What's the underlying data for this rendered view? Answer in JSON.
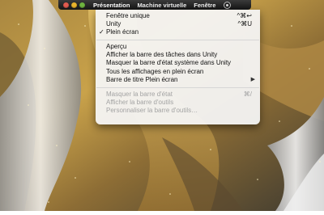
{
  "menubar": {
    "traffic_lights": [
      {
        "name": "close",
        "color": "#e25b4f"
      },
      {
        "name": "minimize",
        "color": "#e9b32c"
      },
      {
        "name": "zoom",
        "color": "#6fb33f"
      }
    ],
    "menus": [
      "Présentation",
      "Machine virtuelle",
      "Fenêtre"
    ],
    "active_menu": "Présentation",
    "status_icon": "vm-status-icon"
  },
  "dropdown": {
    "groups": [
      [
        {
          "label": "Fenêtre unique",
          "shortcut": "^⌘↩",
          "checked": false,
          "enabled": true
        },
        {
          "label": "Unity",
          "shortcut": "^⌘U",
          "checked": false,
          "enabled": true
        },
        {
          "label": "Plein écran",
          "shortcut": "",
          "checked": true,
          "enabled": true
        }
      ],
      [
        {
          "label": "Aperçu",
          "shortcut": "",
          "checked": false,
          "enabled": true
        },
        {
          "label": "Afficher la barre des tâches dans Unity",
          "shortcut": "",
          "checked": false,
          "enabled": true
        },
        {
          "label": "Masquer la barre d'état système dans Unity",
          "shortcut": "",
          "checked": false,
          "enabled": true
        },
        {
          "label": "Tous les affichages en plein écran",
          "shortcut": "",
          "checked": false,
          "enabled": true
        },
        {
          "label": "Barre de titre Plein écran",
          "shortcut": "",
          "checked": false,
          "enabled": true,
          "submenu": true
        }
      ],
      [
        {
          "label": "Masquer la barre d'état",
          "shortcut": "⌘/",
          "checked": false,
          "enabled": false
        },
        {
          "label": "Afficher la barre d'outils",
          "shortcut": "",
          "checked": false,
          "enabled": false
        },
        {
          "label": "Personnaliser la barre d'outils…",
          "shortcut": "",
          "checked": false,
          "enabled": false
        }
      ]
    ],
    "check_glyph": "✓",
    "submenu_glyph": "▶"
  },
  "colors": {
    "desktop_gold": "#c9a24a",
    "desktop_dark": "#4a4436",
    "desktop_silver": "#d8d8d8"
  }
}
